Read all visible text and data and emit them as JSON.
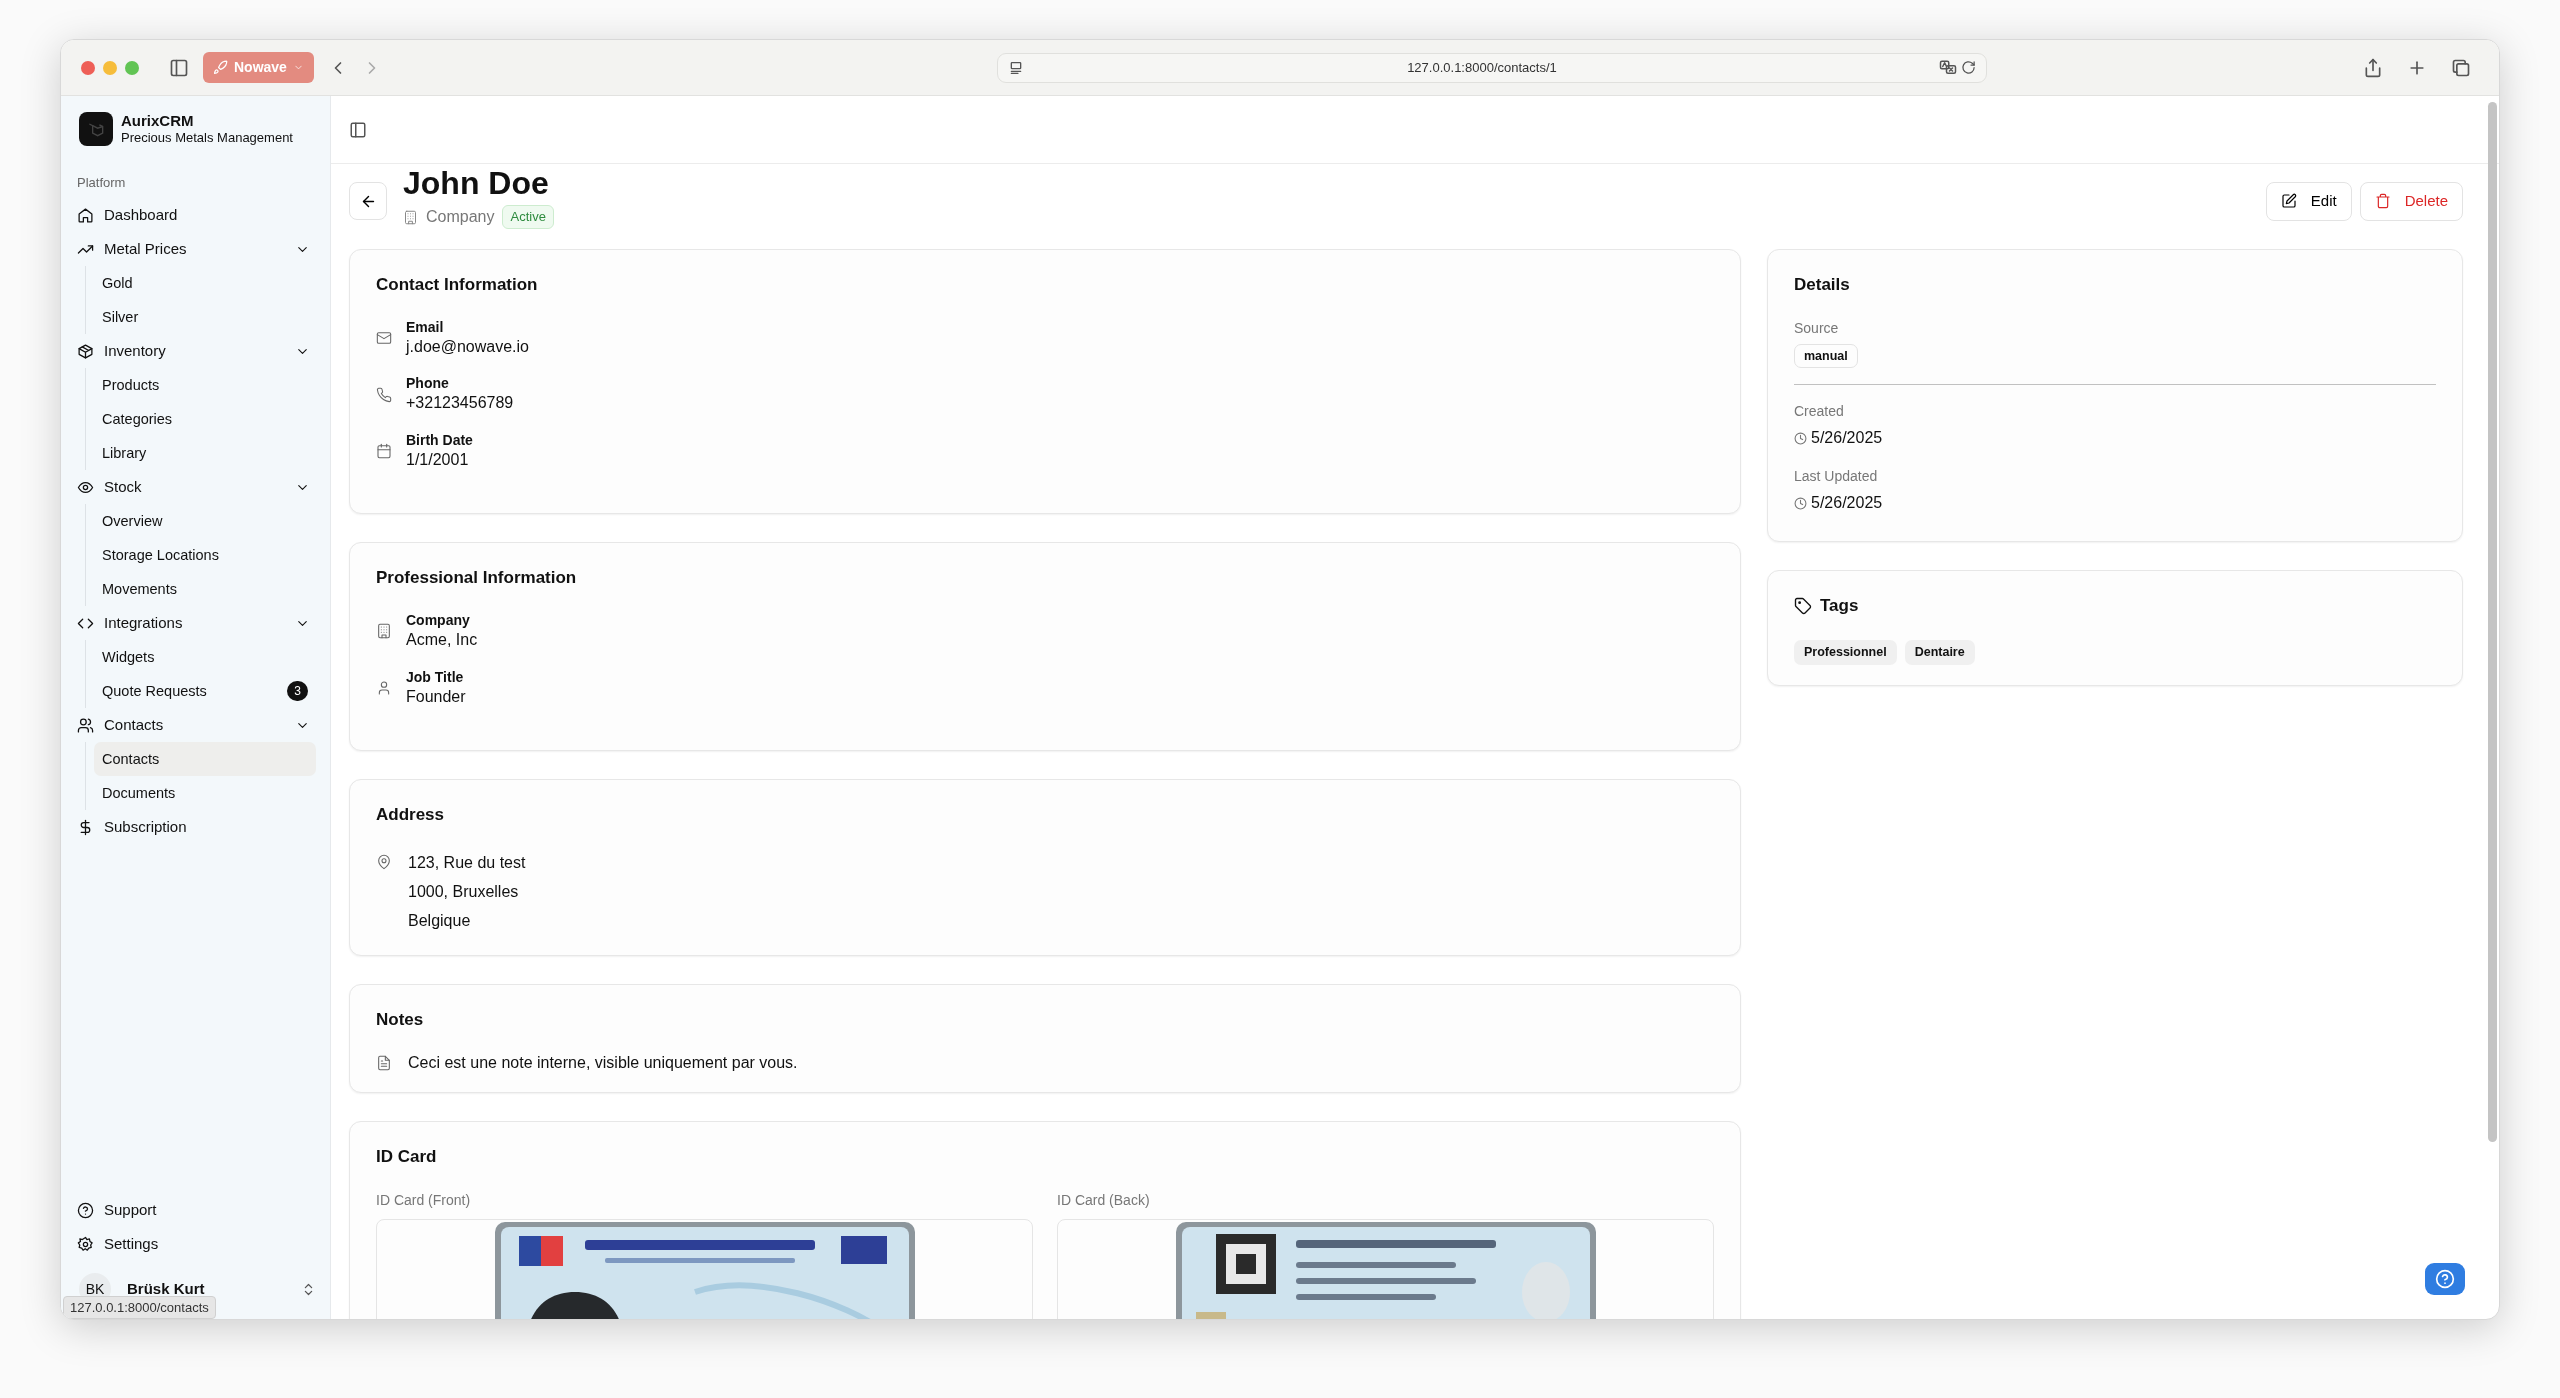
{
  "browser": {
    "tab_group": "Nowave",
    "url": "127.0.0.1:8000/contacts/1",
    "status_url": "127.0.0.1:8000/contacts"
  },
  "sidebar": {
    "brand": {
      "name": "AurixCRM",
      "subtitle": "Precious Metals Management"
    },
    "section_label": "Platform",
    "items": [
      {
        "label": "Dashboard",
        "kind": "home",
        "selected": false
      },
      {
        "label": "Metal Prices",
        "kind": "trend",
        "selected": false,
        "expanded": true,
        "children": [
          {
            "label": "Gold",
            "selected": false
          },
          {
            "label": "Silver",
            "selected": false
          }
        ]
      },
      {
        "label": "Inventory",
        "kind": "box",
        "selected": false,
        "expanded": true,
        "children": [
          {
            "label": "Products",
            "selected": false
          },
          {
            "label": "Categories",
            "selected": false
          },
          {
            "label": "Library",
            "selected": false
          }
        ]
      },
      {
        "label": "Stock",
        "kind": "eye",
        "selected": false,
        "expanded": true,
        "children": [
          {
            "label": "Overview",
            "selected": false
          },
          {
            "label": "Storage Locations",
            "selected": false
          },
          {
            "label": "Movements",
            "selected": false
          }
        ]
      },
      {
        "label": "Integrations",
        "kind": "code",
        "selected": false,
        "expanded": true,
        "children": [
          {
            "label": "Widgets",
            "selected": false
          },
          {
            "label": "Quote Requests",
            "selected": false,
            "badge": "3"
          }
        ]
      },
      {
        "label": "Contacts",
        "kind": "users",
        "selected": false,
        "expanded": true,
        "children": [
          {
            "label": "Contacts",
            "selected": true
          },
          {
            "label": "Documents",
            "selected": false
          }
        ]
      },
      {
        "label": "Subscription",
        "kind": "dollar",
        "selected": false
      }
    ],
    "footer_items": [
      {
        "label": "Support",
        "kind": "help"
      },
      {
        "label": "Settings",
        "kind": "gear"
      }
    ],
    "user": {
      "initials": "BK",
      "name": "Brüsk Kurt"
    }
  },
  "header": {
    "title": "John Doe",
    "type": "Company",
    "status": "Active",
    "buttons": [
      {
        "label": "Edit",
        "kind": "edit"
      },
      {
        "label": "Delete",
        "kind": "delete"
      }
    ]
  },
  "sections": [
    {
      "title": "Contact Information",
      "fields": [
        {
          "label": "Email",
          "value": "j.doe@nowave.io",
          "kind": "mail"
        },
        {
          "label": "Phone",
          "value": "+32123456789",
          "kind": "phone"
        },
        {
          "label": "Birth Date",
          "value": "1/1/2001",
          "kind": "calendar"
        }
      ]
    },
    {
      "title": "Professional Information",
      "fields": [
        {
          "label": "Company",
          "value": "Acme, Inc",
          "kind": "building"
        },
        {
          "label": "Job Title",
          "value": "Founder",
          "kind": "user"
        }
      ]
    },
    {
      "title": "Address",
      "address_lines": [
        "123, Rue du test",
        "1000, Bruxelles",
        "Belgique"
      ]
    },
    {
      "title": "Notes",
      "note": "Ceci est une note interne, visible uniquement par vous."
    },
    {
      "title": "ID Card",
      "images": [
        {
          "label": "ID Card (Front)",
          "kind": "picture"
        },
        {
          "label": "ID Card (Back)",
          "kind": "picture"
        }
      ]
    }
  ],
  "details": {
    "title": "Details",
    "source_label": "Source",
    "source": "manual",
    "created_label": "Created",
    "created": "5/26/2025",
    "updated_label": "Last Updated",
    "updated": "5/26/2025"
  },
  "tags": {
    "title": "Tags",
    "items": [
      "Professionnel",
      "Dentaire"
    ]
  }
}
